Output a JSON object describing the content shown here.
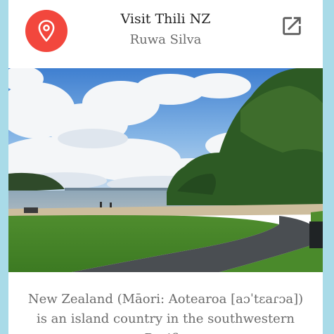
{
  "header": {
    "title": "Visit Thili NZ",
    "subtitle": "Ruwa Silva",
    "location_icon": "location-pin-icon",
    "external_icon": "open-in-new-icon",
    "accent_color": "#f2473d"
  },
  "photo": {
    "description_alt": "Beach park with lawn, path, trees and cloudy sky"
  },
  "body": {
    "description": "New Zealand (Māori: Aotearoa [aɔˈtɛaɾɔa]) is an island country in the southwestern Pacific"
  }
}
